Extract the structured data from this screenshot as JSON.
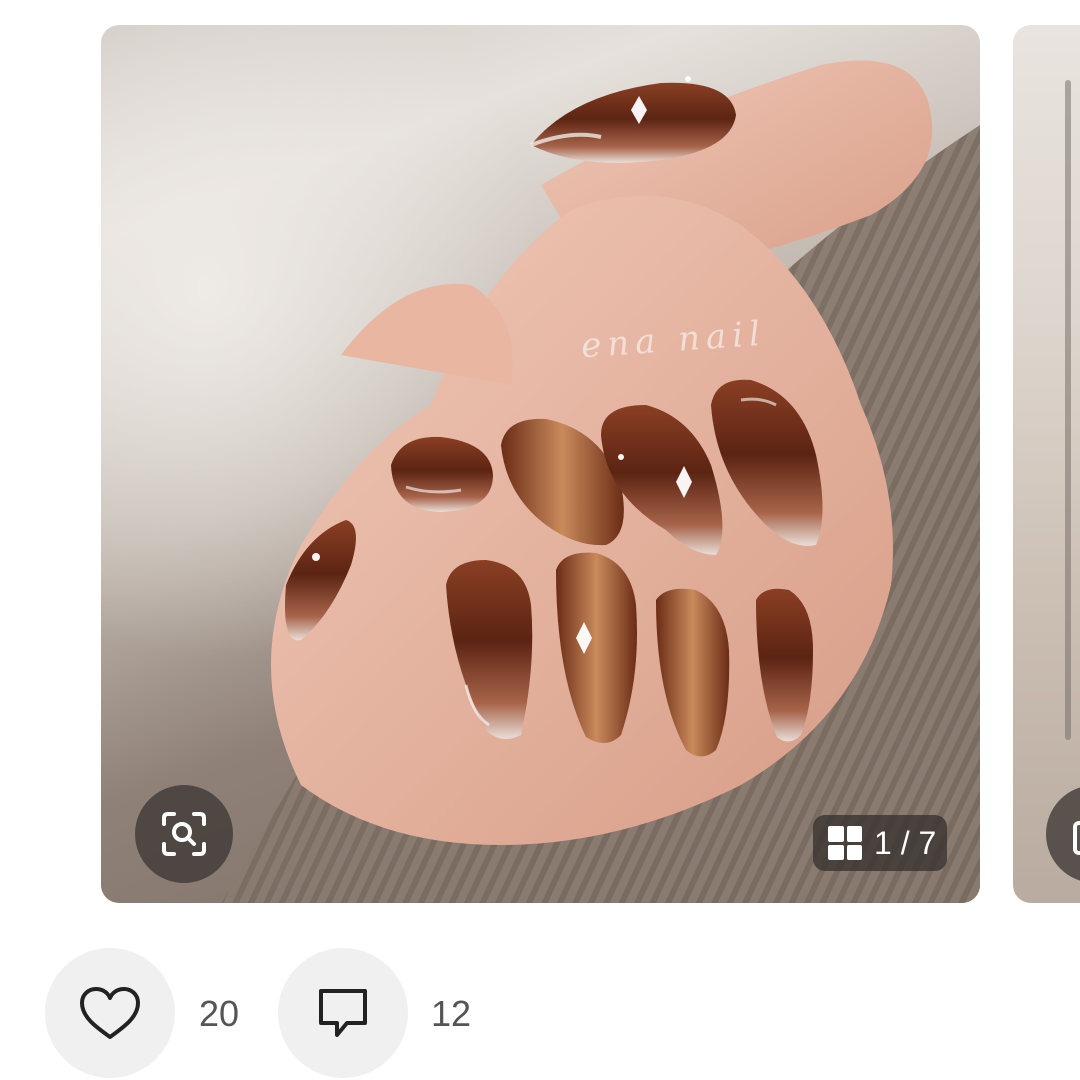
{
  "post": {
    "watermark": "ena nail",
    "image_counter": "1 / 7"
  },
  "actions": {
    "likes": "20",
    "comments": "12"
  },
  "icons": {
    "lens": "image-search-icon",
    "gallery": "grid-icon",
    "like": "heart-outline-icon",
    "comment": "speech-bubble-icon"
  },
  "colors": {
    "card_overlay": "#3c3734",
    "action_bg": "#f0f0f0",
    "count_text": "#555555"
  }
}
